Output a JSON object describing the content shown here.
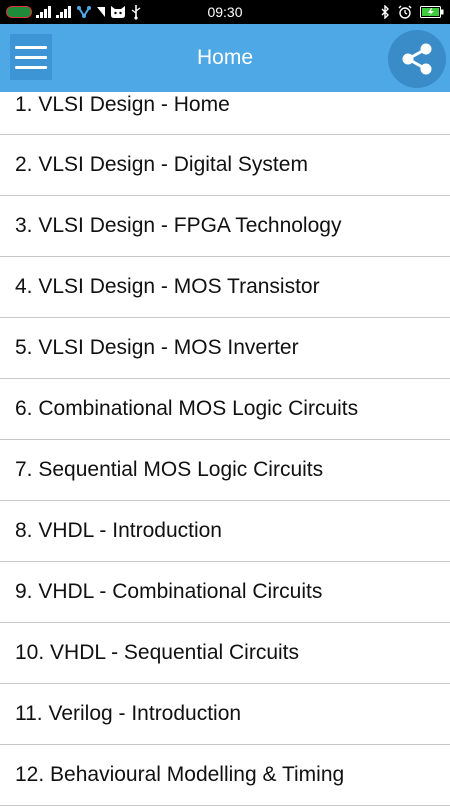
{
  "status_bar": {
    "time": "09:30",
    "icons": [
      "carrier-logo",
      "signal-icon",
      "signal-icon",
      "network-icon",
      "notification-icon",
      "cat-icon",
      "usb-icon",
      "bluetooth-icon",
      "alarm-icon",
      "battery-charging-icon"
    ]
  },
  "app_bar": {
    "title": "Home",
    "menu_icon": "hamburger-menu-icon",
    "share_icon": "share-icon",
    "color": "#4ea8e6"
  },
  "list": {
    "items": [
      "1. VLSI Design - Home",
      "2. VLSI Design - Digital System",
      "3. VLSI Design - FPGA Technology",
      "4. VLSI Design - MOS Transistor",
      "5. VLSI Design - MOS Inverter",
      "6. Combinational MOS Logic Circuits",
      "7. Sequential MOS Logic Circuits",
      "8. VHDL - Introduction",
      "9. VHDL - Combinational Circuits",
      "10. VHDL - Sequential Circuits",
      "11. Verilog - Introduction",
      "12. Behavioural Modelling & Timing"
    ]
  }
}
